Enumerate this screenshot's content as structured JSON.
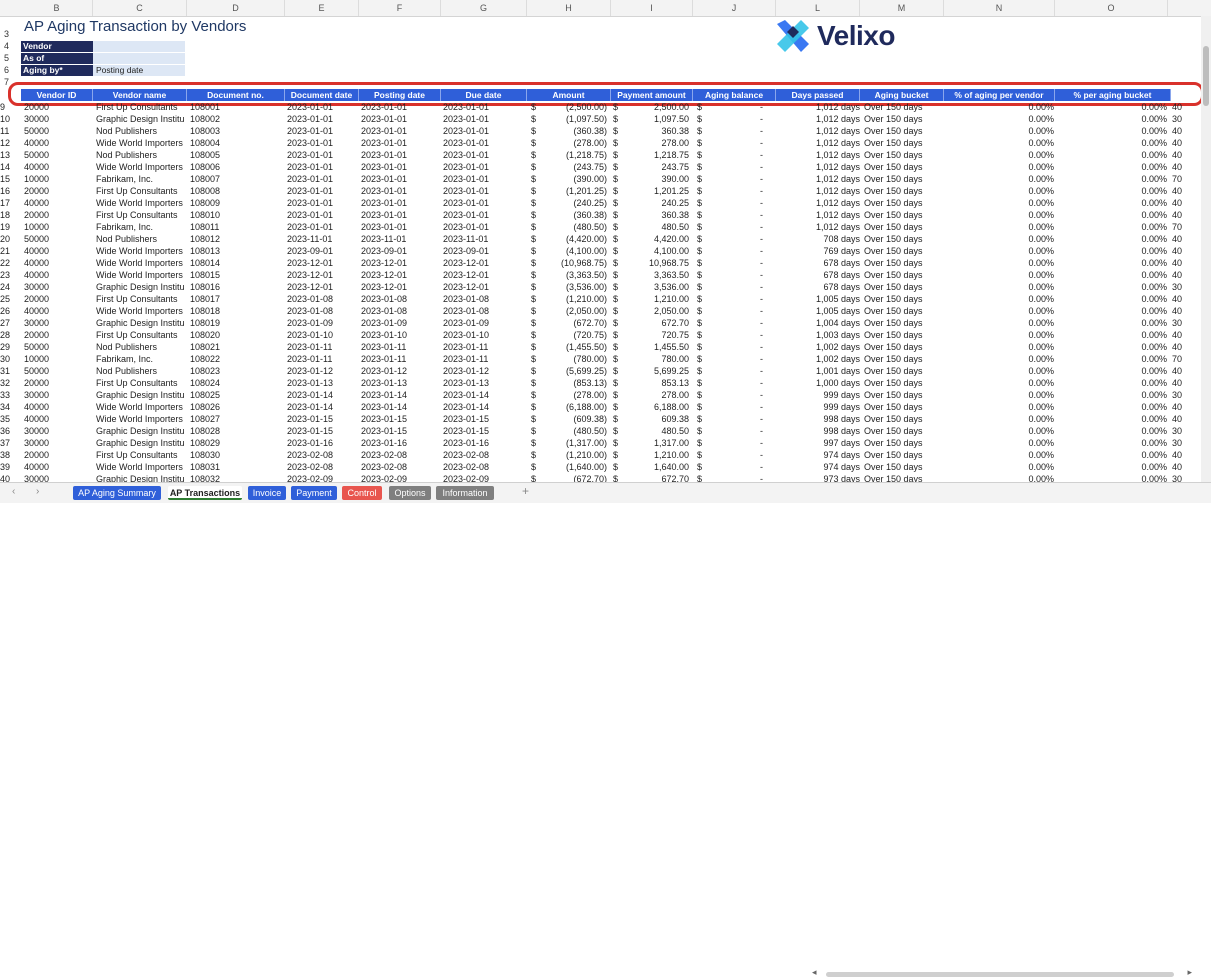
{
  "column_letters": [
    "B",
    "C",
    "D",
    "E",
    "F",
    "G",
    "H",
    "I",
    "J",
    "L",
    "M",
    "N",
    "O"
  ],
  "title": "AP Aging Transaction by Vendors",
  "params": [
    {
      "label": "Vendor",
      "value": ""
    },
    {
      "label": "As of",
      "value": ""
    },
    {
      "label": "Aging by*",
      "value": "Posting date"
    }
  ],
  "logo_text": "Velixo",
  "header_row_number": "7",
  "param_row_numbers": [
    "3",
    "4",
    "5",
    "6"
  ],
  "table_headers": [
    "Vendor ID",
    "Vendor name",
    "Document no.",
    "Document date",
    "Posting date",
    "Due date",
    "Amount",
    "Payment amount",
    "Aging balance",
    "Days passed",
    "Aging bucket",
    "% of aging per vendor",
    "% per aging bucket"
  ],
  "rows": [
    [
      "9",
      "20000",
      "First Up Consultants",
      "108001",
      "2023-01-01",
      "2023-01-01",
      "2023-01-01",
      "$",
      "(2,500.00)",
      "$",
      "2,500.00",
      "$",
      "-",
      "1,012 days",
      "Over 150 days",
      "0.00%",
      "0.00%",
      "40"
    ],
    [
      "10",
      "30000",
      "Graphic Design Institu",
      "108002",
      "2023-01-01",
      "2023-01-01",
      "2023-01-01",
      "$",
      "(1,097.50)",
      "$",
      "1,097.50",
      "$",
      "-",
      "1,012 days",
      "Over 150 days",
      "0.00%",
      "0.00%",
      "30"
    ],
    [
      "11",
      "50000",
      "Nod Publishers",
      "108003",
      "2023-01-01",
      "2023-01-01",
      "2023-01-01",
      "$",
      "(360.38)",
      "$",
      "360.38",
      "$",
      "-",
      "1,012 days",
      "Over 150 days",
      "0.00%",
      "0.00%",
      "40"
    ],
    [
      "12",
      "40000",
      "Wide World Importers",
      "108004",
      "2023-01-01",
      "2023-01-01",
      "2023-01-01",
      "$",
      "(278.00)",
      "$",
      "278.00",
      "$",
      "-",
      "1,012 days",
      "Over 150 days",
      "0.00%",
      "0.00%",
      "40"
    ],
    [
      "13",
      "50000",
      "Nod Publishers",
      "108005",
      "2023-01-01",
      "2023-01-01",
      "2023-01-01",
      "$",
      "(1,218.75)",
      "$",
      "1,218.75",
      "$",
      "-",
      "1,012 days",
      "Over 150 days",
      "0.00%",
      "0.00%",
      "40"
    ],
    [
      "14",
      "40000",
      "Wide World Importers",
      "108006",
      "2023-01-01",
      "2023-01-01",
      "2023-01-01",
      "$",
      "(243.75)",
      "$",
      "243.75",
      "$",
      "-",
      "1,012 days",
      "Over 150 days",
      "0.00%",
      "0.00%",
      "40"
    ],
    [
      "15",
      "10000",
      "Fabrikam, Inc.",
      "108007",
      "2023-01-01",
      "2023-01-01",
      "2023-01-01",
      "$",
      "(390.00)",
      "$",
      "390.00",
      "$",
      "-",
      "1,012 days",
      "Over 150 days",
      "0.00%",
      "0.00%",
      "70"
    ],
    [
      "16",
      "20000",
      "First Up Consultants",
      "108008",
      "2023-01-01",
      "2023-01-01",
      "2023-01-01",
      "$",
      "(1,201.25)",
      "$",
      "1,201.25",
      "$",
      "-",
      "1,012 days",
      "Over 150 days",
      "0.00%",
      "0.00%",
      "40"
    ],
    [
      "17",
      "40000",
      "Wide World Importers",
      "108009",
      "2023-01-01",
      "2023-01-01",
      "2023-01-01",
      "$",
      "(240.25)",
      "$",
      "240.25",
      "$",
      "-",
      "1,012 days",
      "Over 150 days",
      "0.00%",
      "0.00%",
      "40"
    ],
    [
      "18",
      "20000",
      "First Up Consultants",
      "108010",
      "2023-01-01",
      "2023-01-01",
      "2023-01-01",
      "$",
      "(360.38)",
      "$",
      "360.38",
      "$",
      "-",
      "1,012 days",
      "Over 150 days",
      "0.00%",
      "0.00%",
      "40"
    ],
    [
      "19",
      "10000",
      "Fabrikam, Inc.",
      "108011",
      "2023-01-01",
      "2023-01-01",
      "2023-01-01",
      "$",
      "(480.50)",
      "$",
      "480.50",
      "$",
      "-",
      "1,012 days",
      "Over 150 days",
      "0.00%",
      "0.00%",
      "70"
    ],
    [
      "20",
      "50000",
      "Nod Publishers",
      "108012",
      "2023-11-01",
      "2023-11-01",
      "2023-11-01",
      "$",
      "(4,420.00)",
      "$",
      "4,420.00",
      "$",
      "-",
      "708 days",
      "Over 150 days",
      "0.00%",
      "0.00%",
      "40"
    ],
    [
      "21",
      "40000",
      "Wide World Importers",
      "108013",
      "2023-09-01",
      "2023-09-01",
      "2023-09-01",
      "$",
      "(4,100.00)",
      "$",
      "4,100.00",
      "$",
      "-",
      "769 days",
      "Over 150 days",
      "0.00%",
      "0.00%",
      "40"
    ],
    [
      "22",
      "40000",
      "Wide World Importers",
      "108014",
      "2023-12-01",
      "2023-12-01",
      "2023-12-01",
      "$",
      "(10,968.75)",
      "$",
      "10,968.75",
      "$",
      "-",
      "678 days",
      "Over 150 days",
      "0.00%",
      "0.00%",
      "40"
    ],
    [
      "23",
      "40000",
      "Wide World Importers",
      "108015",
      "2023-12-01",
      "2023-12-01",
      "2023-12-01",
      "$",
      "(3,363.50)",
      "$",
      "3,363.50",
      "$",
      "-",
      "678 days",
      "Over 150 days",
      "0.00%",
      "0.00%",
      "40"
    ],
    [
      "24",
      "30000",
      "Graphic Design Institu",
      "108016",
      "2023-12-01",
      "2023-12-01",
      "2023-12-01",
      "$",
      "(3,536.00)",
      "$",
      "3,536.00",
      "$",
      "-",
      "678 days",
      "Over 150 days",
      "0.00%",
      "0.00%",
      "30"
    ],
    [
      "25",
      "20000",
      "First Up Consultants",
      "108017",
      "2023-01-08",
      "2023-01-08",
      "2023-01-08",
      "$",
      "(1,210.00)",
      "$",
      "1,210.00",
      "$",
      "-",
      "1,005 days",
      "Over 150 days",
      "0.00%",
      "0.00%",
      "40"
    ],
    [
      "26",
      "40000",
      "Wide World Importers",
      "108018",
      "2023-01-08",
      "2023-01-08",
      "2023-01-08",
      "$",
      "(2,050.00)",
      "$",
      "2,050.00",
      "$",
      "-",
      "1,005 days",
      "Over 150 days",
      "0.00%",
      "0.00%",
      "40"
    ],
    [
      "27",
      "30000",
      "Graphic Design Institu",
      "108019",
      "2023-01-09",
      "2023-01-09",
      "2023-01-09",
      "$",
      "(672.70)",
      "$",
      "672.70",
      "$",
      "-",
      "1,004 days",
      "Over 150 days",
      "0.00%",
      "0.00%",
      "30"
    ],
    [
      "28",
      "20000",
      "First Up Consultants",
      "108020",
      "2023-01-10",
      "2023-01-10",
      "2023-01-10",
      "$",
      "(720.75)",
      "$",
      "720.75",
      "$",
      "-",
      "1,003 days",
      "Over 150 days",
      "0.00%",
      "0.00%",
      "40"
    ],
    [
      "29",
      "50000",
      "Nod Publishers",
      "108021",
      "2023-01-11",
      "2023-01-11",
      "2023-01-11",
      "$",
      "(1,455.50)",
      "$",
      "1,455.50",
      "$",
      "-",
      "1,002 days",
      "Over 150 days",
      "0.00%",
      "0.00%",
      "40"
    ],
    [
      "30",
      "10000",
      "Fabrikam, Inc.",
      "108022",
      "2023-01-11",
      "2023-01-11",
      "2023-01-11",
      "$",
      "(780.00)",
      "$",
      "780.00",
      "$",
      "-",
      "1,002 days",
      "Over 150 days",
      "0.00%",
      "0.00%",
      "70"
    ],
    [
      "31",
      "50000",
      "Nod Publishers",
      "108023",
      "2023-01-12",
      "2023-01-12",
      "2023-01-12",
      "$",
      "(5,699.25)",
      "$",
      "5,699.25",
      "$",
      "-",
      "1,001 days",
      "Over 150 days",
      "0.00%",
      "0.00%",
      "40"
    ],
    [
      "32",
      "20000",
      "First Up Consultants",
      "108024",
      "2023-01-13",
      "2023-01-13",
      "2023-01-13",
      "$",
      "(853.13)",
      "$",
      "853.13",
      "$",
      "-",
      "1,000 days",
      "Over 150 days",
      "0.00%",
      "0.00%",
      "40"
    ],
    [
      "33",
      "30000",
      "Graphic Design Institu",
      "108025",
      "2023-01-14",
      "2023-01-14",
      "2023-01-14",
      "$",
      "(278.00)",
      "$",
      "278.00",
      "$",
      "-",
      "999 days",
      "Over 150 days",
      "0.00%",
      "0.00%",
      "30"
    ],
    [
      "34",
      "40000",
      "Wide World Importers",
      "108026",
      "2023-01-14",
      "2023-01-14",
      "2023-01-14",
      "$",
      "(6,188.00)",
      "$",
      "6,188.00",
      "$",
      "-",
      "999 days",
      "Over 150 days",
      "0.00%",
      "0.00%",
      "40"
    ],
    [
      "35",
      "40000",
      "Wide World Importers",
      "108027",
      "2023-01-15",
      "2023-01-15",
      "2023-01-15",
      "$",
      "(609.38)",
      "$",
      "609.38",
      "$",
      "-",
      "998 days",
      "Over 150 days",
      "0.00%",
      "0.00%",
      "40"
    ],
    [
      "36",
      "30000",
      "Graphic Design Institu",
      "108028",
      "2023-01-15",
      "2023-01-15",
      "2023-01-15",
      "$",
      "(480.50)",
      "$",
      "480.50",
      "$",
      "-",
      "998 days",
      "Over 150 days",
      "0.00%",
      "0.00%",
      "30"
    ],
    [
      "37",
      "30000",
      "Graphic Design Institu",
      "108029",
      "2023-01-16",
      "2023-01-16",
      "2023-01-16",
      "$",
      "(1,317.00)",
      "$",
      "1,317.00",
      "$",
      "-",
      "997 days",
      "Over 150 days",
      "0.00%",
      "0.00%",
      "30"
    ],
    [
      "38",
      "20000",
      "First Up Consultants",
      "108030",
      "2023-02-08",
      "2023-02-08",
      "2023-02-08",
      "$",
      "(1,210.00)",
      "$",
      "1,210.00",
      "$",
      "-",
      "974 days",
      "Over 150 days",
      "0.00%",
      "0.00%",
      "40"
    ],
    [
      "39",
      "40000",
      "Wide World Importers",
      "108031",
      "2023-02-08",
      "2023-02-08",
      "2023-02-08",
      "$",
      "(1,640.00)",
      "$",
      "1,640.00",
      "$",
      "-",
      "974 days",
      "Over 150 days",
      "0.00%",
      "0.00%",
      "40"
    ],
    [
      "40",
      "30000",
      "Graphic Design Institu",
      "108032",
      "2023-02-09",
      "2023-02-09",
      "2023-02-09",
      "$",
      "(672.70)",
      "$",
      "672.70",
      "$",
      "-",
      "973 days",
      "Over 150 days",
      "0.00%",
      "0.00%",
      "30"
    ]
  ],
  "sheet_tabs": [
    {
      "label": "AP Aging Summary",
      "color": "#2f5fd9",
      "active": false
    },
    {
      "label": "AP Transactions",
      "color": "#ffffff",
      "active": true
    },
    {
      "label": "Invoice",
      "color": "#2f5fd9",
      "active": false
    },
    {
      "label": "Payment",
      "color": "#2f5fd9",
      "active": false
    },
    {
      "label": "Control",
      "color": "#e8554e",
      "active": false
    },
    {
      "label": "Options",
      "color": "#7f7f7f",
      "active": false
    },
    {
      "label": "Information",
      "color": "#7f7f7f",
      "active": false
    }
  ],
  "add_sheet_label": "+",
  "colors": {
    "header_blue": "#2f5fd9",
    "param_navy": "#1f2a5c",
    "highlight_red": "#d9312b",
    "logo_navy": "#1f2a5c",
    "logo_blue": "#3a78f2",
    "logo_cyan": "#34c3e8"
  }
}
